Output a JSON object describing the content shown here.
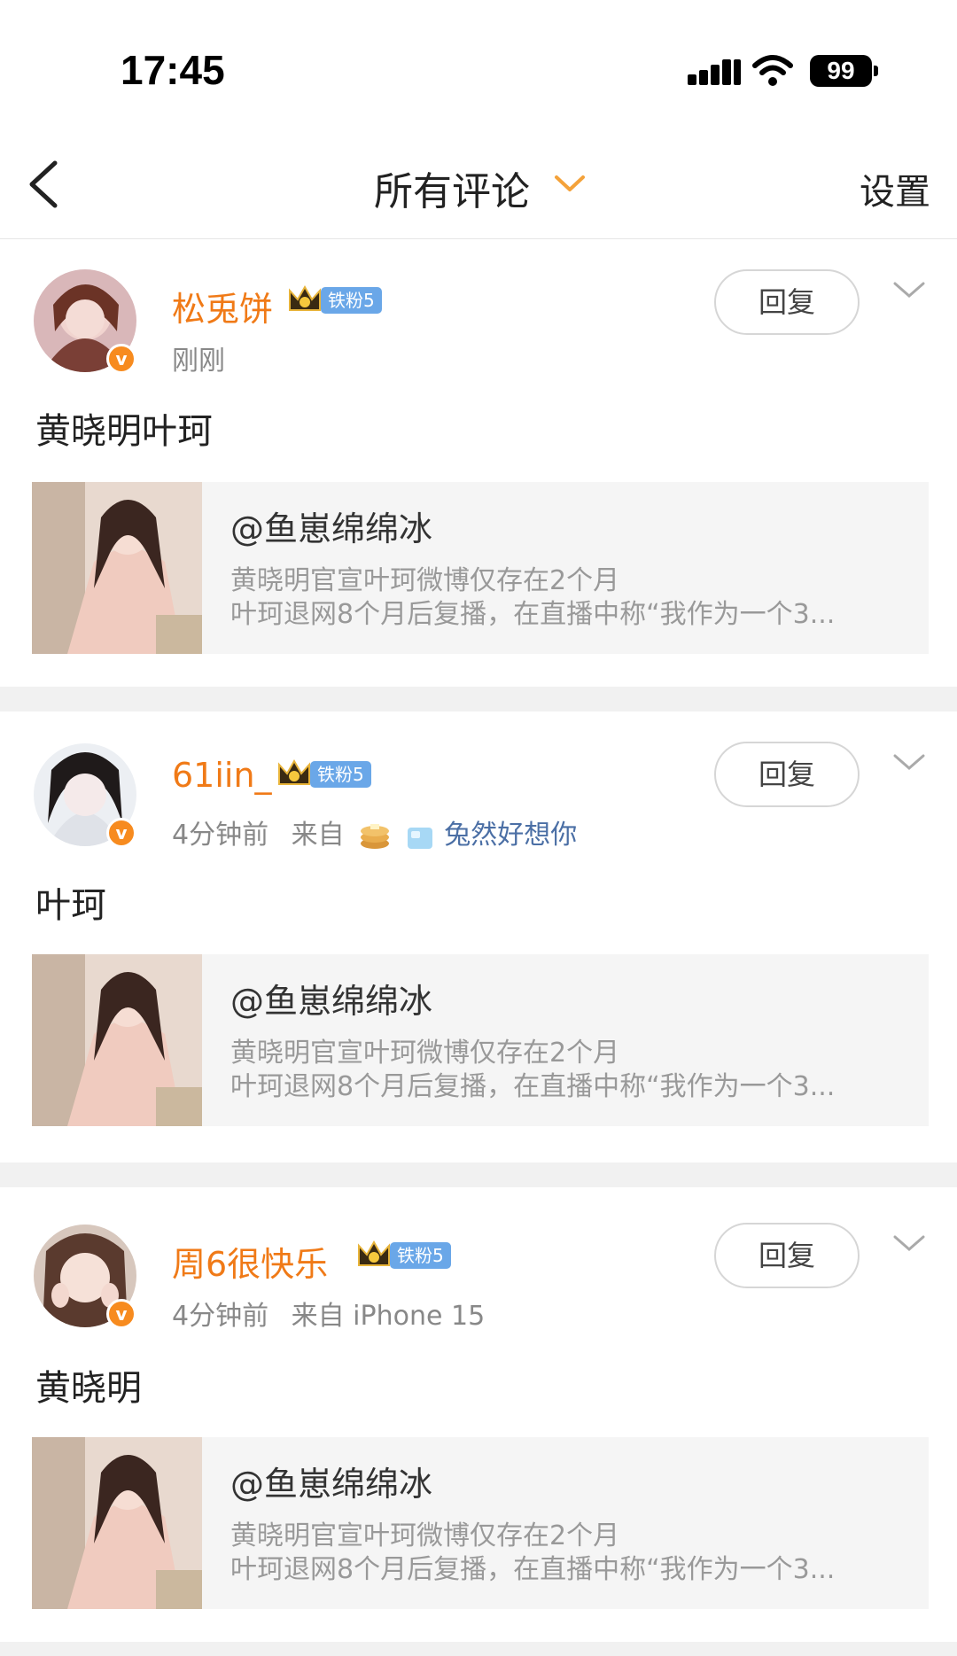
{
  "status_bar": {
    "time": "17:45",
    "battery": "99",
    "icons": [
      "signal-icon",
      "wifi-icon",
      "battery-icon"
    ]
  },
  "nav": {
    "title": "所有评论",
    "settings": "设置",
    "accent_color": "#f4a23a"
  },
  "comments": [
    {
      "username": "松兎饼",
      "fan_badge": "铁粉5",
      "meta": "刚刚",
      "source_prefix": "",
      "source_link": "",
      "reply": "回复",
      "content": "黄晓明叶珂",
      "quote": {
        "title": "@鱼崽绵绵冰",
        "line1": "黄晓明官宣叶珂微博仅存在2个月",
        "line2": "叶珂退网8个月后复播，在直播中称“我作为一个3..."
      }
    },
    {
      "username": "61iin_",
      "fan_badge": "铁粉5",
      "meta": "4分钟前",
      "source_prefix": "来自",
      "source_link": "兔然好想你",
      "reply": "回复",
      "content": "叶珂",
      "quote": {
        "title": "@鱼崽绵绵冰",
        "line1": "黄晓明官宣叶珂微博仅存在2个月",
        "line2": "叶珂退网8个月后复播，在直播中称“我作为一个3..."
      }
    },
    {
      "username": "周6很快乐",
      "fan_badge": "铁粉5",
      "meta": "4分钟前",
      "source_prefix": "来自 iPhone 15",
      "source_link": "",
      "reply": "回复",
      "content": "黄晓明",
      "quote": {
        "title": "@鱼崽绵绵冰",
        "line1": "黄晓明官宣叶珂微博仅存在2个月",
        "line2": "叶珂退网8个月后复播，在直播中称“我作为一个3..."
      }
    }
  ]
}
